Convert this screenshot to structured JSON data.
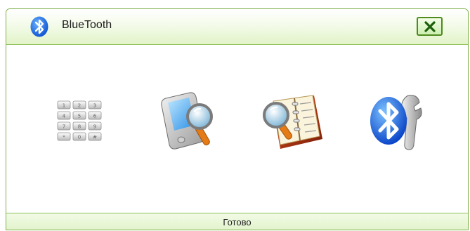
{
  "window": {
    "title": "BlueTooth",
    "accent_color": "#7fb04c",
    "icons": {
      "title": "bluetooth-icon",
      "close": "close-x-icon"
    }
  },
  "toolbar": {
    "items": [
      {
        "icon": "dial-keypad-icon"
      },
      {
        "icon": "search-device-icon"
      },
      {
        "icon": "search-contacts-book-icon"
      },
      {
        "icon": "bluetooth-settings-icon"
      }
    ]
  },
  "status": {
    "text": "Готово"
  }
}
